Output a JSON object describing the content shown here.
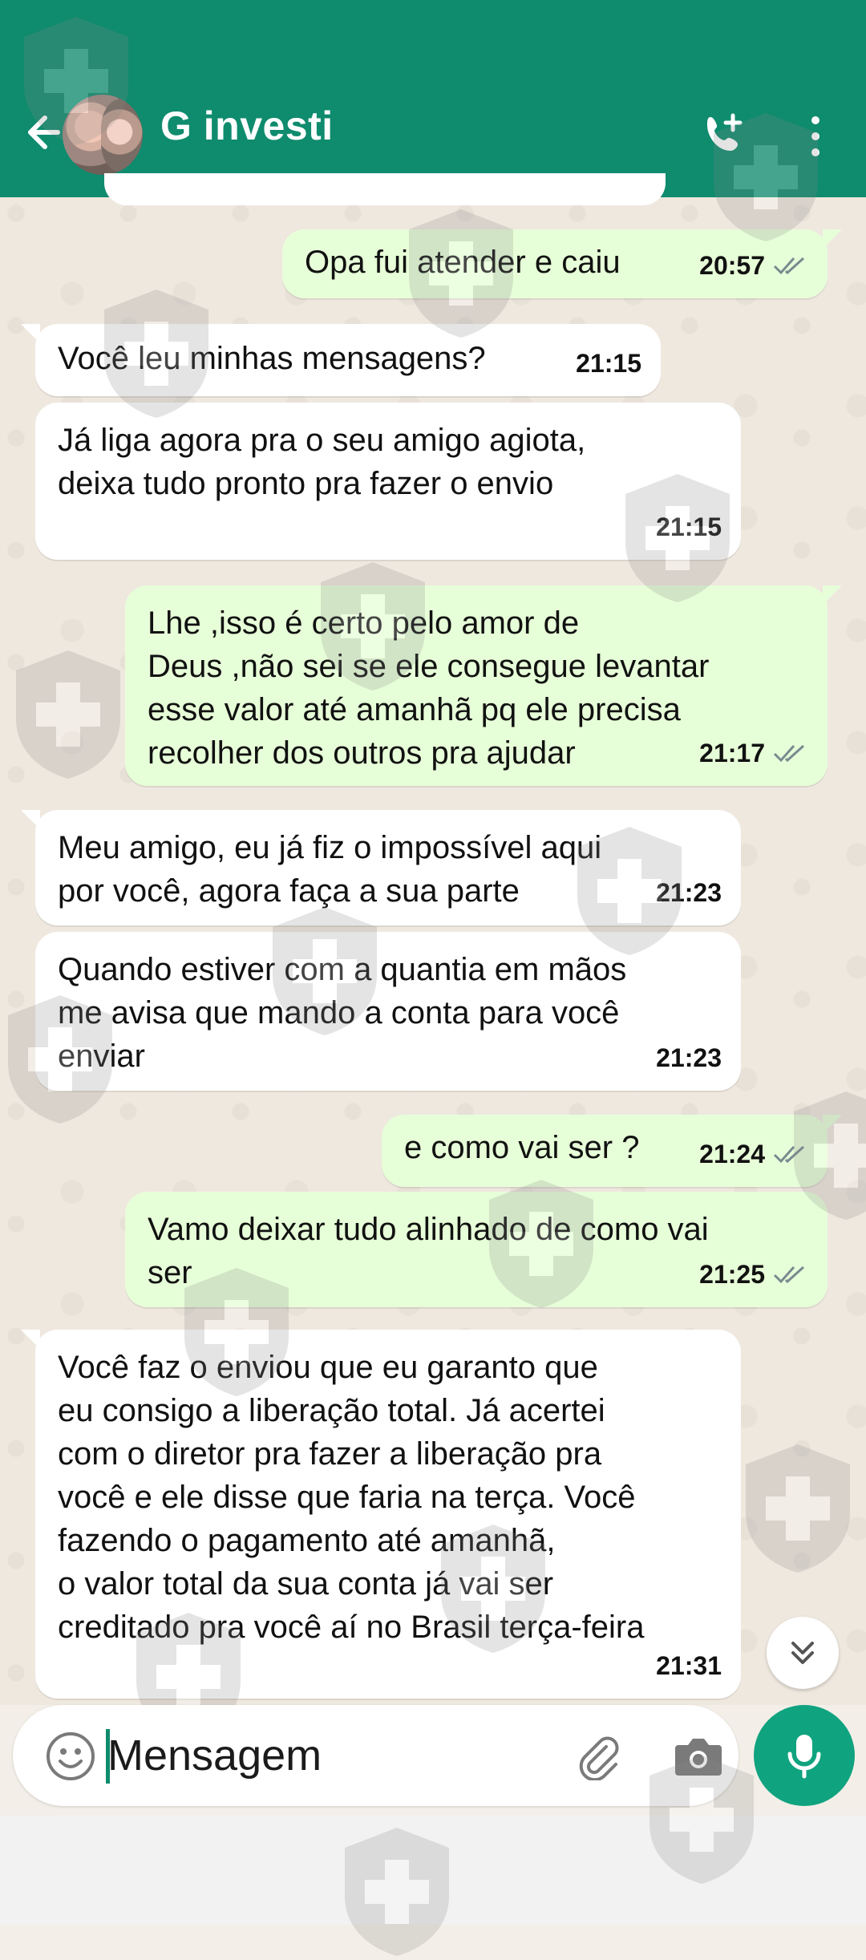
{
  "header": {
    "title": "G investi",
    "back_icon": "arrow-left-icon",
    "call_icon": "phone-plus-icon",
    "menu_icon": "more-vertical-icon"
  },
  "messages": [
    {
      "dir": "out",
      "text": "Opa fui atender e caiu",
      "time": "20:57",
      "ticks": "double-check-icon"
    },
    {
      "dir": "in",
      "text": "Você leu minhas mensagens?",
      "time": "21:15"
    },
    {
      "dir": "in",
      "text": "Já liga agora pra o seu amigo agiota,\ndeixa tudo pronto pra fazer o envio",
      "time": "21:15"
    },
    {
      "dir": "out",
      "text": "Lhe ,isso é certo pelo amor de\nDeus ,não sei se ele consegue levantar\nesse valor até amanhã pq ele precisa\nrecolher dos outros pra ajudar",
      "time": "21:17",
      "ticks": "double-check-icon"
    },
    {
      "dir": "in",
      "text": "Meu amigo, eu já fiz o impossível aqui\npor você, agora faça a sua parte",
      "time": "21:23"
    },
    {
      "dir": "in",
      "text": "Quando estiver com a quantia em mãos\nme avisa que mando a conta para você\nenviar",
      "time": "21:23"
    },
    {
      "dir": "out",
      "text": "e como vai ser ?",
      "time": "21:24",
      "ticks": "double-check-icon"
    },
    {
      "dir": "out",
      "text": "Vamo deixar tudo alinhado de como vai\nser",
      "time": "21:25",
      "ticks": "double-check-icon"
    },
    {
      "dir": "in",
      "text": "Você faz o enviou que eu garanto que\neu consigo a liberação total. Já acertei\ncom o diretor pra fazer a liberação pra\nvocê e ele disse que faria na terça. Você\nfazendo o pagamento até amanhã,\no valor total da sua conta já vai ser\ncreditado pra você aí no Brasil terça-feira",
      "time": "21:31"
    }
  ],
  "composer": {
    "placeholder": "Mensagem",
    "emoji_icon": "emoji-icon",
    "attach_icon": "paperclip-icon",
    "camera_icon": "camera-icon",
    "mic_icon": "microphone-icon"
  },
  "scroll_down_icon": "double-chevron-down-icon",
  "colors": {
    "header": "#0f8b6e",
    "outgoing_bubble": "#e7ffd8",
    "incoming_bubble": "#ffffff",
    "chat_background": "#efe8df",
    "mic_button": "#10a37f"
  }
}
